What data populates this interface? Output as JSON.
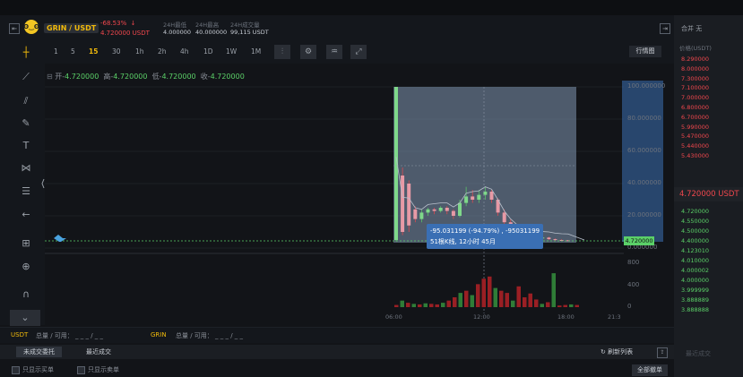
{
  "header": {
    "pair": "GRIN / USDT",
    "change": "-68.53%",
    "arrow": "↓",
    "price": "4.720000 USDT",
    "stats": [
      {
        "label": "24H最低",
        "value": "4.000000"
      },
      {
        "label": "24H最高",
        "value": "40.000000"
      },
      {
        "label": "24H成交量",
        "value": "99,115 USDT"
      }
    ]
  },
  "timeframes": [
    "1",
    "5",
    "15",
    "30",
    "1h",
    "2h",
    "4h",
    "1D",
    "1W",
    "1M"
  ],
  "active_timeframe": "15",
  "view_button": "行情图",
  "ohlc": {
    "open_label": "开-",
    "open": "4.720000",
    "high_label": "高-",
    "high": "4.720000",
    "low_label": "低-",
    "low": "4.720000",
    "close_label": "收-",
    "close": "4.720000"
  },
  "tooltip": {
    "line1": "-95.031199 (-94.79%) , -95031199",
    "line2": "51根K线, 12小时 45月"
  },
  "chart_data": {
    "type": "candlestick",
    "price_axis": [
      "100.000000",
      "80.000000",
      "60.000000",
      "40.000000",
      "20.000000",
      "0.000000"
    ],
    "ylim": [
      0,
      100
    ],
    "volume_axis": [
      "800",
      "400",
      "0"
    ],
    "vol_ylim": [
      0,
      900
    ],
    "time_axis": [
      "06:00",
      "12:00",
      "18:00",
      "21:3"
    ],
    "current_price": "4.720000",
    "candles": [
      {
        "o": 5,
        "c": 100,
        "h": 100,
        "l": 4
      },
      {
        "o": 45,
        "c": 10,
        "h": 50,
        "l": 8
      },
      {
        "o": 40,
        "c": 14,
        "h": 42,
        "l": 10
      },
      {
        "o": 24,
        "c": 18,
        "h": 26,
        "l": 16
      },
      {
        "o": 18,
        "c": 22,
        "h": 24,
        "l": 16
      },
      {
        "o": 22,
        "c": 24,
        "h": 25,
        "l": 20
      },
      {
        "o": 24,
        "c": 23,
        "h": 25,
        "l": 21
      },
      {
        "o": 23,
        "c": 25,
        "h": 26,
        "l": 22
      },
      {
        "o": 25,
        "c": 23,
        "h": 26,
        "l": 21
      },
      {
        "o": 23,
        "c": 20,
        "h": 24,
        "l": 18
      },
      {
        "o": 20,
        "c": 28,
        "h": 30,
        "l": 19
      },
      {
        "o": 28,
        "c": 32,
        "h": 38,
        "l": 26
      },
      {
        "o": 32,
        "c": 30,
        "h": 36,
        "l": 28
      },
      {
        "o": 30,
        "c": 33,
        "h": 36,
        "l": 28
      },
      {
        "o": 33,
        "c": 35,
        "h": 38,
        "l": 30
      },
      {
        "o": 35,
        "c": 30,
        "h": 36,
        "l": 28
      },
      {
        "o": 30,
        "c": 22,
        "h": 31,
        "l": 20
      },
      {
        "o": 22,
        "c": 16,
        "h": 24,
        "l": 14
      },
      {
        "o": 16,
        "c": 12,
        "h": 18,
        "l": 10
      },
      {
        "o": 12,
        "c": 9,
        "h": 14,
        "l": 8
      },
      {
        "o": 9,
        "c": 8,
        "h": 10,
        "l": 6
      },
      {
        "o": 8,
        "c": 7,
        "h": 9,
        "l": 6
      },
      {
        "o": 7,
        "c": 6,
        "h": 8,
        "l": 5
      },
      {
        "o": 6,
        "c": 6.5,
        "h": 7,
        "l": 5
      },
      {
        "o": 6.5,
        "c": 5.5,
        "h": 7,
        "l": 5
      },
      {
        "o": 5.5,
        "c": 5,
        "h": 6,
        "l": 4.5
      },
      {
        "o": 5,
        "c": 4.8,
        "h": 5.5,
        "l": 4.2
      },
      {
        "o": 4.8,
        "c": 4.72,
        "h": 5,
        "l": 4.5
      }
    ],
    "volumes": [
      40,
      120,
      80,
      60,
      50,
      70,
      60,
      50,
      80,
      120,
      180,
      260,
      300,
      220,
      420,
      520,
      560,
      350,
      300,
      260,
      120,
      380,
      180,
      250,
      140,
      60,
      90,
      620,
      30,
      40,
      50,
      40
    ],
    "volume_colors": [
      "red",
      "green",
      "red",
      "green",
      "red",
      "green",
      "red",
      "red",
      "green",
      "red",
      "red",
      "green",
      "red",
      "green",
      "red",
      "red",
      "red",
      "green",
      "red",
      "red",
      "green",
      "red",
      "red",
      "red",
      "red",
      "green",
      "red",
      "green",
      "red",
      "red",
      "green",
      "red"
    ]
  },
  "right_panel": {
    "title": "合并 无",
    "price_label": "价格(USDT)",
    "asks": [
      "8.290000",
      "8.000000",
      "7.300000",
      "7.100000",
      "7.000000",
      "6.800000",
      "6.700000",
      "5.990000",
      "5.470000",
      "5.440000",
      "5.430000"
    ],
    "current": "4.720000 USDT",
    "bids": [
      "4.720000",
      "4.550000",
      "4.500000",
      "4.400000",
      "4.123010",
      "4.010000",
      "4.000002",
      "4.000000",
      "3.999999",
      "3.888889",
      "3.888888"
    ],
    "footer": "最近成交"
  },
  "balance": {
    "usdt_code": "USDT",
    "usdt_text": "总量 / 可用： _ _ _ / _ _",
    "grin_code": "GRIN",
    "grin_text": "总量 / 可用： _ _ _ / _ _"
  },
  "order_tabs": [
    "未成交委托",
    "最近成交"
  ],
  "refresh_label": "刷新列表",
  "filters": [
    "只显示买单",
    "只显示卖单"
  ],
  "cancel_all": "全部撤单",
  "colors": {
    "up": "#5bd068",
    "down": "#f0474d",
    "accent": "#f0b90b"
  }
}
